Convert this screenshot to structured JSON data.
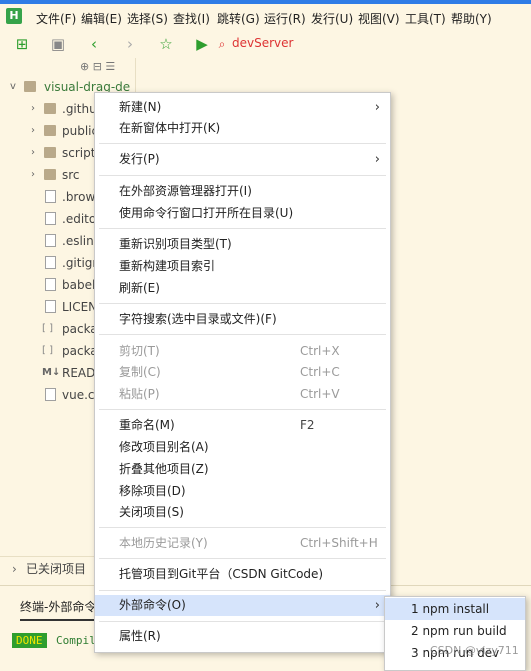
{
  "menubar": {
    "logo": "H",
    "items": [
      "文件(F)",
      "编辑(E)",
      "选择(S)",
      "查找(I)",
      "跳转(G)",
      "运行(R)",
      "发行(U)",
      "视图(V)",
      "工具(T)",
      "帮助(Y)"
    ]
  },
  "toolbar": {
    "run_config": "devServer"
  },
  "project_tree": {
    "root": "visual-drag-de",
    "items": [
      {
        "label": ".github",
        "type": "folder"
      },
      {
        "label": "public",
        "type": "folder"
      },
      {
        "label": "scripts",
        "type": "folder"
      },
      {
        "label": "src",
        "type": "folder"
      },
      {
        "label": ".brows",
        "type": "file"
      },
      {
        "label": ".editor",
        "type": "file"
      },
      {
        "label": ".eslintr",
        "type": "file"
      },
      {
        "label": ".gitign",
        "type": "file"
      },
      {
        "label": "babel.",
        "type": "file"
      },
      {
        "label": "LICEN",
        "type": "file"
      },
      {
        "label": "packa",
        "type": "file"
      },
      {
        "label": "packa",
        "type": "file"
      },
      {
        "label": "READM",
        "type": "file"
      },
      {
        "label": "vue.co",
        "type": "file"
      }
    ],
    "closed_projects": "已关闭项目"
  },
  "context_menu": {
    "new": "新建(N)",
    "open_new_window": "在新窗体中打开(K)",
    "publish": "发行(P)",
    "open_in_explorer": "在外部资源管理器打开(I)",
    "open_cmd": "使用命令行窗口打开所在目录(U)",
    "reidentify": "重新识别项目类型(T)",
    "rebuild_index": "重新构建项目索引",
    "refresh": "刷新(E)",
    "char_search": "字符搜索(选中目录或文件)(F)",
    "cut": "剪切(T)",
    "cut_shortcut": "Ctrl+X",
    "copy": "复制(C)",
    "copy_shortcut": "Ctrl+C",
    "paste": "粘贴(P)",
    "paste_shortcut": "Ctrl+V",
    "rename": "重命名(M)",
    "rename_shortcut": "F2",
    "alias": "修改项目别名(A)",
    "collapse_others": "折叠其他项目(Z)",
    "remove": "移除项目(D)",
    "close": "关闭项目(S)",
    "local_history": "本地历史记录(Y)",
    "local_history_shortcut": "Ctrl+Shift+H",
    "git_host": "托管项目到Git平台（CSDN GitCode)",
    "external_cmd": "外部命令(O)",
    "properties": "属性(R)"
  },
  "submenu": {
    "items": [
      "1 npm install",
      "2 npm run build",
      "3 npm run dev"
    ]
  },
  "terminal": {
    "tab": "终端-外部命令",
    "done": "DONE",
    "compile": "Compil"
  },
  "watermark": "CSDN @vizy711"
}
